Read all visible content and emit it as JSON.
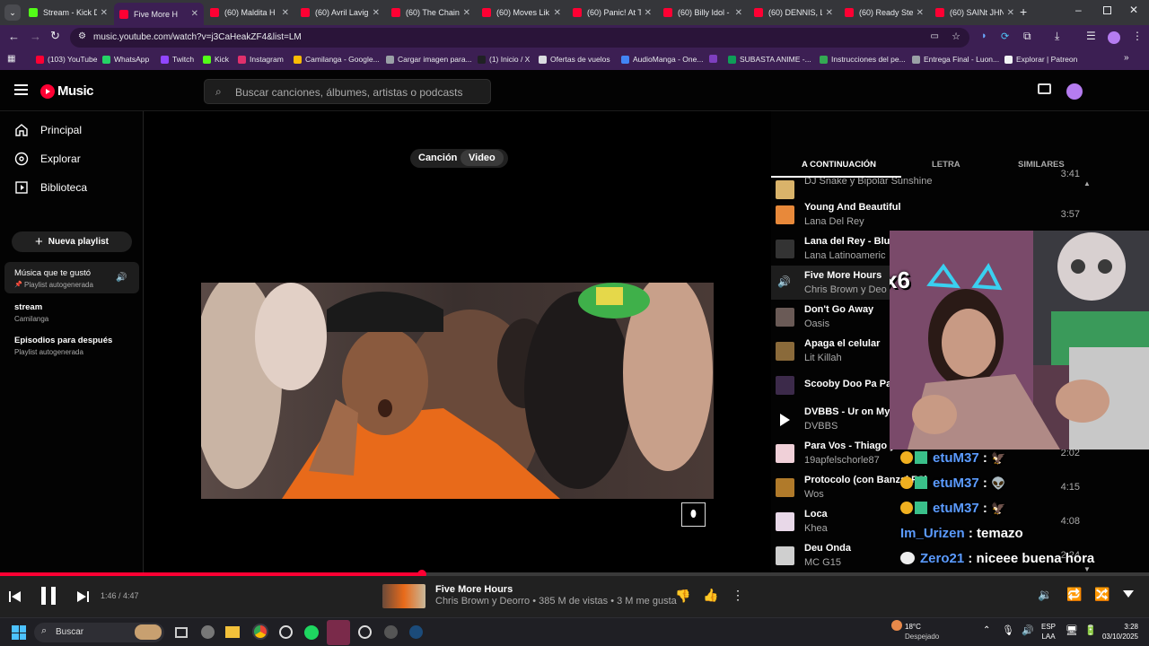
{
  "browser": {
    "tabs": [
      {
        "title": "Stream - Kick D",
        "color": "#53fc18"
      },
      {
        "title": "Five More H",
        "color": "#ff0033"
      },
      {
        "title": "(60) Maldita H",
        "color": "#ff0033"
      },
      {
        "title": "(60) Avril Lavig",
        "color": "#ff0033"
      },
      {
        "title": "(60) The Chain",
        "color": "#ff0033"
      },
      {
        "title": "(60) Moves Lik",
        "color": "#ff0033"
      },
      {
        "title": "(60) Panic! At T",
        "color": "#ff0033"
      },
      {
        "title": "(60) Billy Idol -",
        "color": "#ff0033"
      },
      {
        "title": "(60) DENNIS, L",
        "color": "#ff0033"
      },
      {
        "title": "(60) Ready Ste",
        "color": "#ff0033"
      },
      {
        "title": "(60) SAINt JHN",
        "color": "#ff0033"
      }
    ],
    "url": "music.youtube.com/watch?v=j3CaHeakZF4&list=LM",
    "bookmarks": [
      {
        "label": "(103) YouTube",
        "color": "#ff0033"
      },
      {
        "label": "WhatsApp",
        "color": "#25d366"
      },
      {
        "label": "Twitch",
        "color": "#9146ff"
      },
      {
        "label": "Kick",
        "color": "#53fc18"
      },
      {
        "label": "Instagram",
        "color": "#e1306c"
      },
      {
        "label": "Camilanga - Google...",
        "color": "#fbbc04"
      },
      {
        "label": "Cargar imagen para...",
        "color": "#9aa0a6"
      },
      {
        "label": "(1) Inicio / X",
        "color": "#202124"
      },
      {
        "label": "Ofertas de vuelos",
        "color": "#dadce0"
      },
      {
        "label": "AudioManga - One...",
        "color": "#4285f4"
      },
      {
        "label": "",
        "color": "#7e3fbf"
      },
      {
        "label": "SUBASTA ANIME -...",
        "color": "#0f9d58"
      },
      {
        "label": "Instrucciones del pe...",
        "color": "#34a853"
      },
      {
        "label": "Entrega Final - Luon...",
        "color": "#9aa0a6"
      },
      {
        "label": "Explorar | Patreon",
        "color": "#f1f3f4"
      }
    ]
  },
  "ytm": {
    "logo": "Music",
    "search_placeholder": "Buscar canciones, álbumes, artistas o podcasts",
    "nav": [
      "Principal",
      "Explorar",
      "Biblioteca"
    ],
    "new_playlist": "Nueva playlist",
    "playlists": [
      {
        "name": "Música que te gustó",
        "sub": "Playlist autogenerada"
      },
      {
        "name": "stream",
        "sub": "Camilanga"
      },
      {
        "name": "Episodios para después",
        "sub": "Playlist autogenerada"
      }
    ],
    "toggle": {
      "song": "Canción",
      "video": "Video"
    },
    "queue_tabs": [
      "A CONTINUACIÓN",
      "LETRA",
      "SIMILARES"
    ],
    "queue": [
      {
        "title": "",
        "artist": "DJ Snake y Bipolar Sunshine",
        "dur": "3:41",
        "color": "#d9b36a"
      },
      {
        "title": "Young And Beautiful",
        "artist": "Lana Del Rey",
        "dur": "3:57",
        "color": "#e8893a"
      },
      {
        "title": "Lana del Rey - Blue J",
        "artist": "Lana Latinoameric",
        "dur": "",
        "color": "#333333"
      },
      {
        "title": "Five More Hours",
        "artist": "Chris Brown y Deo",
        "dur": "",
        "color": "#444444"
      },
      {
        "title": "Don't Go Away",
        "artist": "Oasis",
        "dur": "",
        "color": "#6a5a56"
      },
      {
        "title": "Apaga el celular",
        "artist": "Lit Killah",
        "dur": "",
        "color": "#8a6a3a"
      },
      {
        "title": "Scooby Doo Pa Pa (I",
        "artist": "",
        "dur": "",
        "color": "#3c2a4a"
      },
      {
        "title": "DVBBS - Ur on My M",
        "artist": "DVBBS",
        "dur": "",
        "color": "#000000"
      },
      {
        "title": "Para Vos - Thiago y",
        "artist": "19apfelschorle87",
        "dur": "2:02",
        "color": "#f0d0d8"
      },
      {
        "title": "Protocolo (con Banzai FC)",
        "artist": "Wos",
        "dur": "4:15",
        "color": "#b07a2a"
      },
      {
        "title": "Loca",
        "artist": "Khea",
        "dur": "4:08",
        "color": "#e8d8e8"
      },
      {
        "title": "Deu Onda",
        "artist": "MC G15",
        "dur": "2:24",
        "color": "#cfcfcf"
      }
    ],
    "now_playing": {
      "title": "Five More Hours",
      "meta": "Chris Brown y Deorro • 385 M de vistas • 3 M me gusta",
      "time": "1:46 / 4:47",
      "progress": 0.367
    }
  },
  "stream": {
    "combo": "x6",
    "chat": [
      {
        "user": "etuM37",
        "msg": ":",
        "color": "#5b9bff"
      },
      {
        "user": "etuM37",
        "msg": ":",
        "color": "#5b9bff"
      },
      {
        "user": "etuM37",
        "msg": ":",
        "color": "#5b9bff"
      },
      {
        "user": "Im_Urizen",
        "msg": ": temazo",
        "color": "#5b9bff"
      },
      {
        "user": "Zero21",
        "msg": ": niceee buena hora",
        "color": "#5b9bff"
      }
    ]
  },
  "taskbar": {
    "search": "Buscar",
    "weather_temp": "18°C",
    "weather_desc": "Despejado",
    "lang": "ESP",
    "lang2": "LAA",
    "time": "3:28",
    "date": "03/10/2025"
  }
}
